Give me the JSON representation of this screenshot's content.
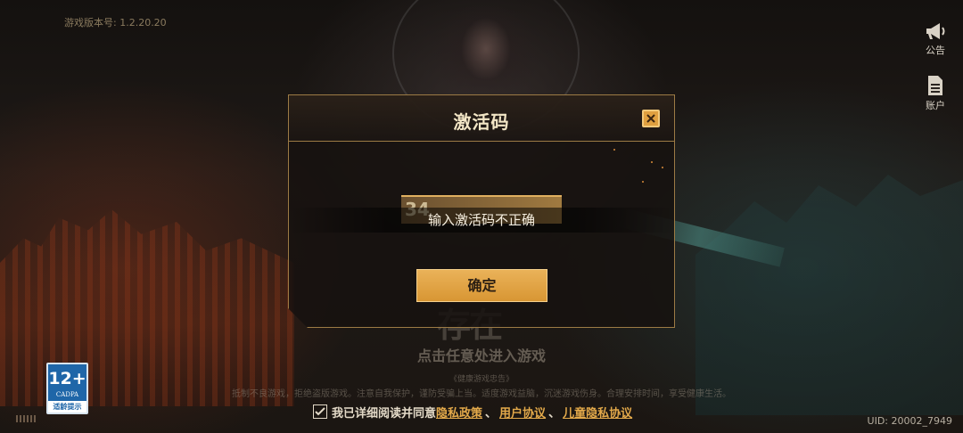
{
  "version_text": "游戏版本号: 1.2.20.20",
  "side_menu": {
    "notice_label": "公告",
    "account_label": "账户"
  },
  "dialog": {
    "title": "激活码",
    "input_value": "34",
    "toast": "输入激活码不正确",
    "confirm_label": "确定"
  },
  "logo_text": "存在",
  "enter_hint": "点击任意处进入游戏",
  "health": {
    "title": "《健康游戏忠告》",
    "text": "抵制不良游戏，拒绝盗版游戏。注意自我保护，谨防受骗上当。适度游戏益脑，沉迷游戏伤身。合理安排时间，享受健康生活。"
  },
  "agreement": {
    "prefix": "我已详细阅读并同意",
    "privacy": "隐私政策",
    "user": "用户协议",
    "child_privacy": "儿童隐私协议",
    "sep": "、"
  },
  "age_rating": {
    "number": "12+",
    "org": "CADPA",
    "tip": "适龄提示"
  },
  "uid": "UID: 20002_7949",
  "colors": {
    "accent": "#e0a040",
    "link": "#e3a94a",
    "border": "#9c7b45"
  }
}
